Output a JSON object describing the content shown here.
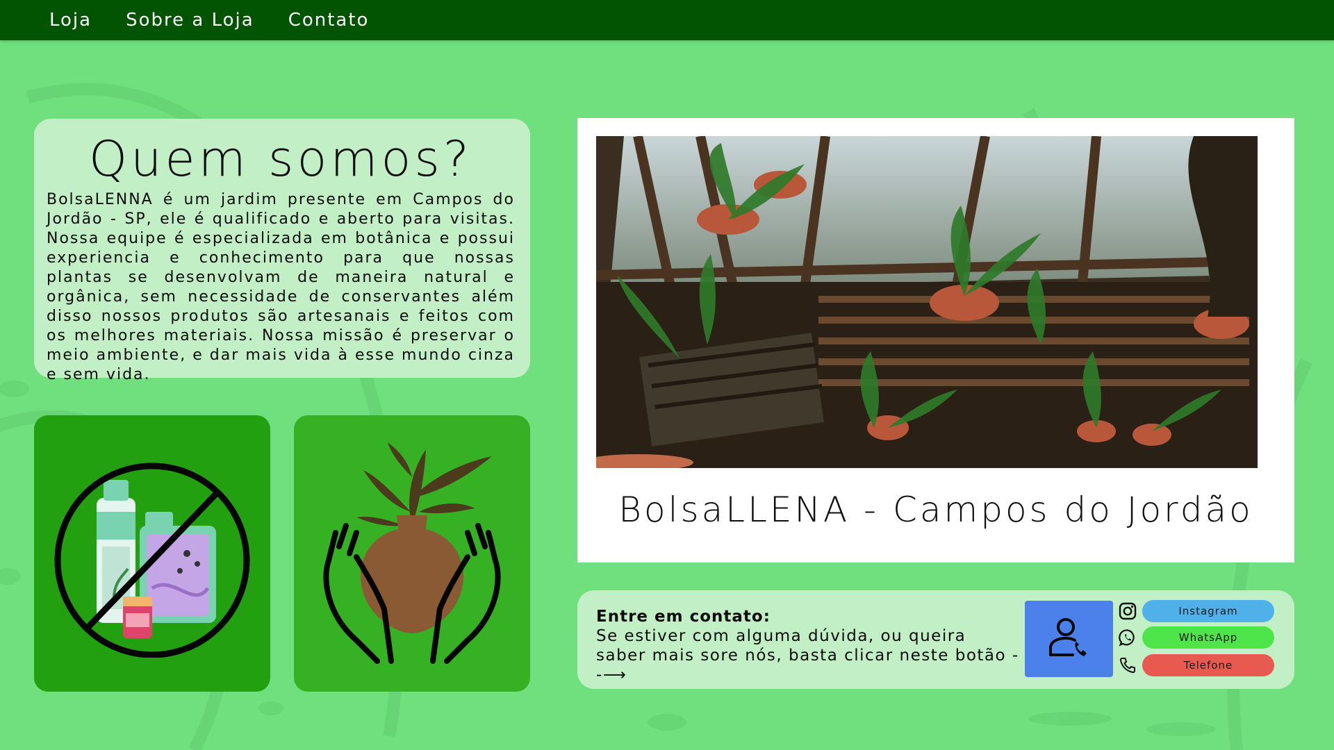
{
  "nav": {
    "items": [
      {
        "label": "Loja"
      },
      {
        "label": "Sobre a Loja"
      },
      {
        "label": "Contato"
      }
    ]
  },
  "about": {
    "title": "Quem somos?",
    "text": "BolsaLENNA é um jardim presente em Campos do Jordão - SP, ele é qualificado e aberto para visitas. Nossa equipe é especializada em botânica e possui experiencia e conhecimento para que nossas plantas se desenvolvam de maneira natural e orgânica, sem necessidade de conservantes além disso nossos produtos são artesanais e feitos com os melhores materiais. Nossa missão é preservar o meio ambiente, e dar mais vida à esse mundo cinza e sem vida."
  },
  "tiles": [
    {
      "icon": "no-chemicals-icon"
    },
    {
      "icon": "hands-holding-plant-icon"
    }
  ],
  "photo": {
    "caption": "BolsaLLENA - Campos do Jordão"
  },
  "contact": {
    "heading": "Entre em contato:",
    "text": "Se estiver com alguma dúvida, ou queira saber mais sore nós, basta clicar neste botão --⟶",
    "buttons": [
      {
        "label": "Instagram",
        "icon": "instagram-icon",
        "color": "#4fb0ea"
      },
      {
        "label": "WhatsApp",
        "icon": "whatsapp-icon",
        "color": "#4ee54a"
      },
      {
        "label": "Telefone",
        "icon": "phone-icon",
        "color": "#e85a4f"
      }
    ]
  },
  "colors": {
    "background": "#6fe07d",
    "navbar": "#025402",
    "card": "#c2efc6",
    "tile_dark": "#23a010",
    "tile_light": "#36b124",
    "contact_button": "#4c80eb"
  }
}
